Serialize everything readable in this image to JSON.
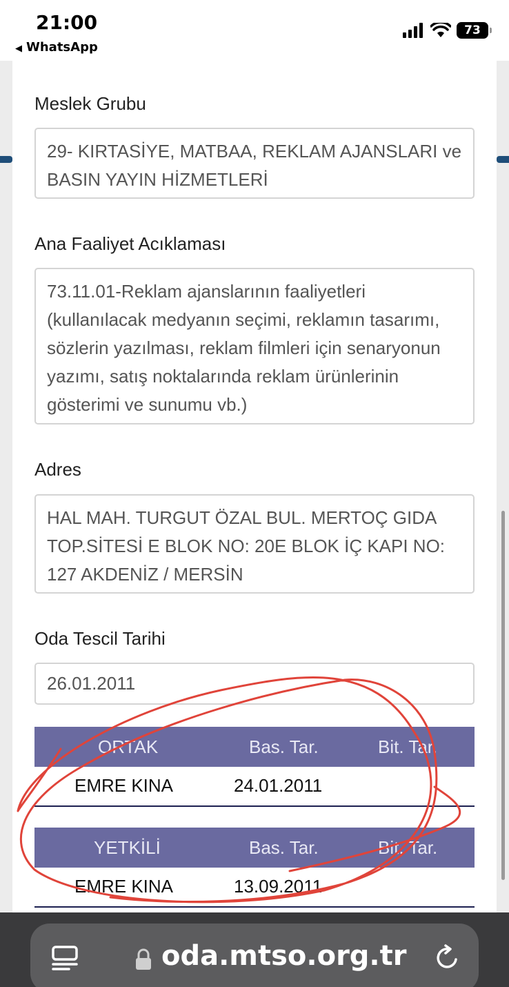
{
  "status_bar": {
    "time": "21:00",
    "back_app": "WhatsApp",
    "battery": "73"
  },
  "form": {
    "fields": [
      {
        "label": "Meslek Grubu",
        "value": "29- KIRTASİYE, MATBAA, REKLAM AJANSLARI ve BASIN YAYIN HİZMETLERİ"
      },
      {
        "label": "Ana Faaliyet Acıklaması",
        "value": "73.11.01-Reklam ajanslarının faaliyetleri (kullanılacak medyanın seçimi, reklamın tasarımı, sözlerin yazılması, reklam filmleri için senaryonun yazımı, satış noktalarında reklam ürünlerinin gösterimi ve sunumu vb.)"
      },
      {
        "label": "Adres",
        "value": "HAL MAH. TURGUT ÖZAL BUL. MERTOÇ GIDA TOP.SİTESİ E BLOK NO: 20E BLOK İÇ KAPI NO: 127 AKDENİZ / MERSİN"
      },
      {
        "label": "Oda Tescil Tarihi",
        "value": "26.01.2011"
      }
    ]
  },
  "tables": [
    {
      "headers": [
        "ORTAK",
        "Bas. Tar.",
        "Bit. Tar."
      ],
      "row": [
        "EMRE  KINA",
        "24.01.2011",
        ""
      ]
    },
    {
      "headers": [
        "YETKİLİ",
        "Bas. Tar.",
        "Bit. Tar."
      ],
      "row": [
        "EMRE  KINA",
        "13.09.2011",
        ""
      ]
    }
  ],
  "browser": {
    "url": "oda.mtso.org.tr"
  },
  "colors": {
    "table_header": "#6a6aa0",
    "annotation": "#e0443a",
    "accent": "#1f4e79"
  }
}
